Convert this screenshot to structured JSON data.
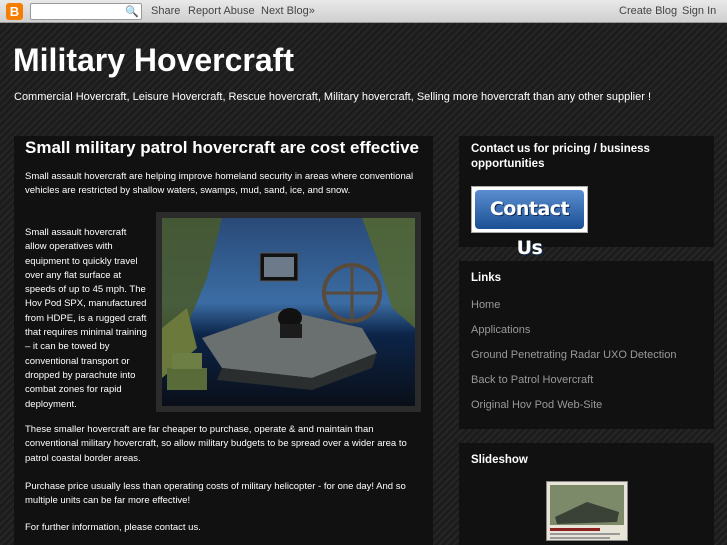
{
  "navbar": {
    "logo": "B",
    "search_placeholder": "",
    "share": "Share",
    "report_abuse": "Report Abuse",
    "next_blog": "Next Blog»",
    "create_blog": "Create Blog",
    "sign_in": "Sign In"
  },
  "header": {
    "title": "Military Hovercraft",
    "description": "Commercial Hovercraft, Leisure Hovercraft, Rescue hovercraft, Military hovercraft, Selling more hovercraft than any other supplier !"
  },
  "post": {
    "title": "Small military patrol hovercraft are cost effective",
    "intro": "Small assault hovercraft are helping improve homeland security in areas where conventional vehicles are restricted by shallow waters, swamps, mud, sand, ice, and snow.",
    "body_left": "Small assault hovercraft allow operatives with equipment to quickly travel over any flat surface at speeds of up to 45 mph. The Hov Pod SPX, manufactured from HDPE, is a rugged craft that requires minimal training – it can be towed by conventional transport or dropped by parachute into combat zones for rapid deployment.",
    "paragraph_2": "These smaller hovercraft are far cheaper to purchase, operate & and maintain than conventional military hovercraft, so allow military budgets to be spread over a wider area to patrol coastal border areas.",
    "paragraph_3": "Purchase price usually less than operating costs of military helicopter - for one day! And so multiple units can be far more effective!",
    "paragraph_4": "For further information, please contact us."
  },
  "sidebar": {
    "contact": {
      "title": "Contact us for pricing / business opportunities",
      "button_label": "Contact Us"
    },
    "links": {
      "title": "Links",
      "items": [
        {
          "label": "Home"
        },
        {
          "label": "Applications"
        },
        {
          "label": "Ground Penetrating Radar UXO Detection"
        },
        {
          "label": "Back to Patrol Hovercraft"
        },
        {
          "label": "Original Hov Pod Web-Site"
        }
      ]
    },
    "slideshow": {
      "title": "Slideshow"
    }
  },
  "colors": {
    "blogger_orange": "#f57d00",
    "contact_button_blue": "#1a4f94"
  }
}
